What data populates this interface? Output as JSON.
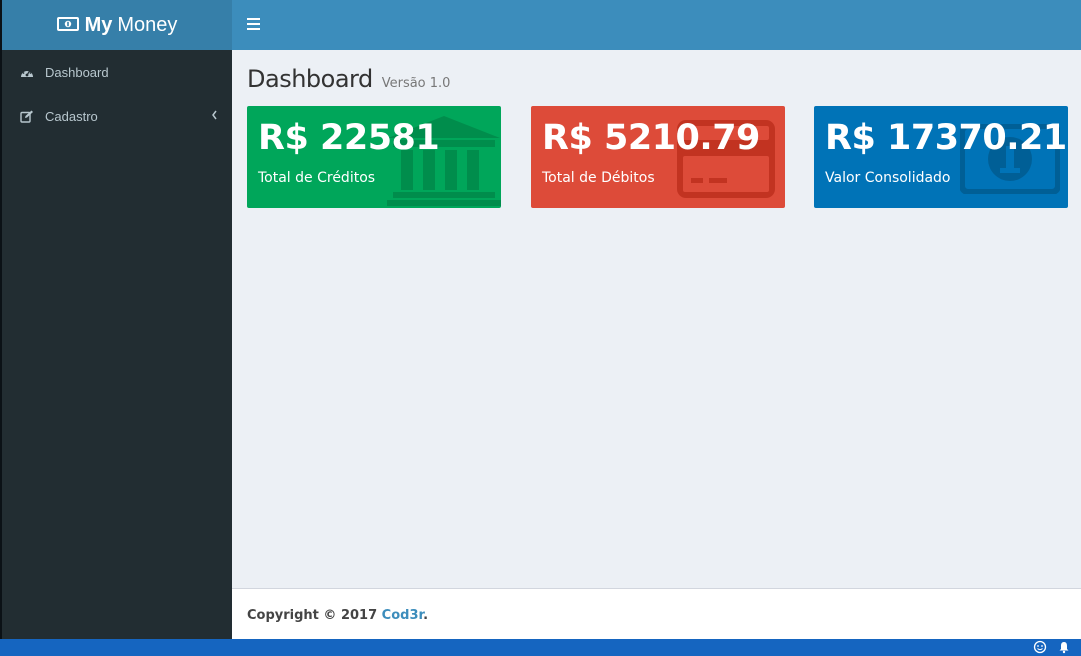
{
  "app": {
    "logo_strong": "My",
    "logo_rest": "Money",
    "logo_icon": "money-icon"
  },
  "sidebar": {
    "items": [
      {
        "label": "Dashboard",
        "icon": "dashboard-icon"
      },
      {
        "label": "Cadastro",
        "icon": "edit-icon",
        "expandable": true
      }
    ]
  },
  "header": {
    "title": "Dashboard",
    "subtitle": "Versão 1.0"
  },
  "boxes": [
    {
      "value": "R$ 22581",
      "label": "Total de Créditos",
      "color": "#00a65a",
      "icon": "bank-icon"
    },
    {
      "value": "R$ 5210.79",
      "label": "Total de Débitos",
      "color": "#dd4b39",
      "icon": "credit-card-icon"
    },
    {
      "value": "R$ 17370.21",
      "label": "Valor Consolidado",
      "color": "#0073b7",
      "icon": "money-bill-icon"
    }
  ],
  "footer": {
    "prefix": "Copyright © 2017",
    "link": "Cod3r",
    "suffix": "."
  },
  "colors": {
    "sidebar": "#222d32",
    "topbar": "#3c8dbc",
    "logo_bg": "#367fa9",
    "content_bg": "#ecf0f5"
  }
}
